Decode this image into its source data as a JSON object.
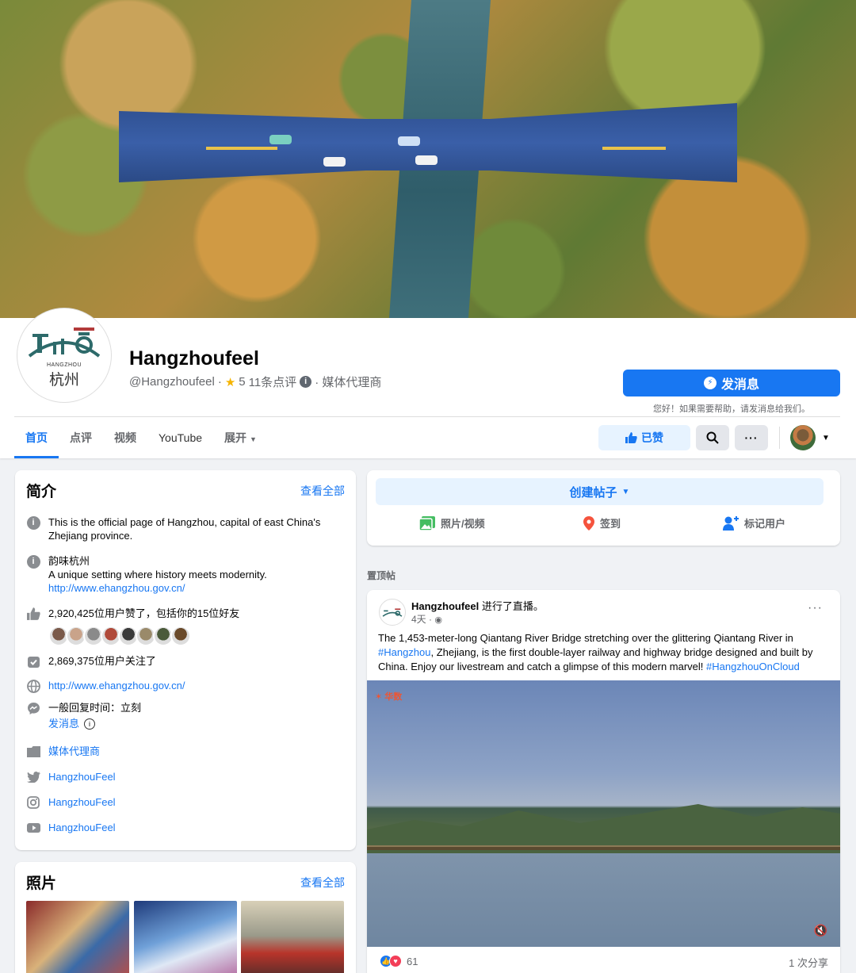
{
  "page": {
    "name": "Hangzhoufeel",
    "handle": "@Hangzhoufeel",
    "rating_prefix": "·",
    "rating": "5",
    "reviews": "11条点评",
    "category": "· 媒体代理商",
    "logo_en": "HANGZHOU",
    "logo_cn": "杭州"
  },
  "actions": {
    "message_button": "发消息",
    "message_hint": "您好！如果需要帮助，请发消息给我们。",
    "liked_button": "已赞"
  },
  "tabs": [
    {
      "label": "首页"
    },
    {
      "label": "点评"
    },
    {
      "label": "视频"
    },
    {
      "label": "YouTube"
    },
    {
      "label": "展开"
    }
  ],
  "intro": {
    "title": "简介",
    "see_all": "查看全部",
    "description": "This is the official page of Hangzhou, capital of east China's Zhejiang province.",
    "about_title": "韵味杭州",
    "about_text": "A unique setting where history meets modernity.",
    "about_link": "http://www.ehangzhou.gov.cn/",
    "likes": "2,920,425位用户赞了，包括你的15位好友",
    "followers": "2,869,375位用户关注了",
    "website": "http://www.ehangzhou.gov.cn/",
    "response_time": "一般回复时间：立刻",
    "send_message": "发消息",
    "category": "媒体代理商",
    "twitter": "HangzhouFeel",
    "instagram": "HangzhouFeel",
    "youtube": "HangzhouFeel",
    "friend_colors": [
      "#7a5a4a",
      "#c9a38a",
      "#8a8a8a",
      "#b04a3a",
      "#3a3a3a",
      "#9a8a6a",
      "#4a5a3a",
      "#6a4a2a"
    ]
  },
  "photos": {
    "title": "照片",
    "see_all": "查看全部"
  },
  "composer": {
    "create_post": "创建帖子",
    "photo_video": "照片/视频",
    "check_in": "签到",
    "tag_people": "标记用户"
  },
  "pinned": {
    "label": "置顶帖",
    "author": "Hangzhoufeel",
    "action": " 进行了直播。",
    "time": "4天 ·",
    "text_1": "The 1,453-meter-long Qiantang River Bridge stretching over the glittering Qiantang River in ",
    "hashtag_1": "#Hangzhou",
    "text_2": ", Zhejiang, is the first double-layer railway and highway bridge designed and built by China. Enjoy our livestream and catch a glimpse of this modern marvel! ",
    "hashtag_2": "#HangzhouOnCloud",
    "watermark": "华数",
    "reactions": "61",
    "shares": "1 次分享"
  },
  "colors": {
    "brand": "#1877f2",
    "background": "#f0f2f5"
  }
}
